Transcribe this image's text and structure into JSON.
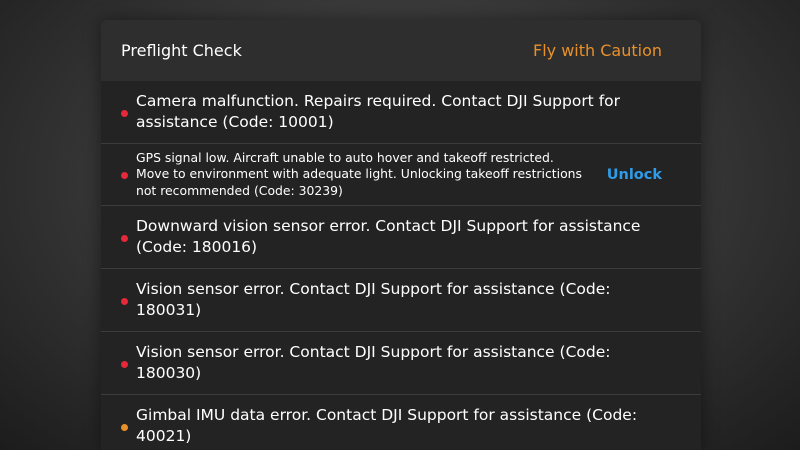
{
  "header": {
    "title": "Preflight Check",
    "status": "Fly with Caution"
  },
  "colors": {
    "error": "#e5283a",
    "warning": "#e8912a",
    "link": "#2e9ce8"
  },
  "items": [
    {
      "severity": "error",
      "message": "Camera malfunction. Repairs required. Contact DJI Support for assistance (Code: 10001)"
    },
    {
      "severity": "error",
      "message": "GPS signal low. Aircraft unable to auto hover and takeoff restricted. Move to environment with adequate light. Unlocking takeoff restrictions not recommended (Code: 30239)",
      "action": "Unlock"
    },
    {
      "severity": "error",
      "message": "Downward vision sensor error. Contact DJI Support for assistance (Code: 180016)"
    },
    {
      "severity": "error",
      "message": "Vision sensor error. Contact DJI Support for assistance (Code: 180031)"
    },
    {
      "severity": "error",
      "message": "Vision sensor error. Contact DJI Support for assistance (Code: 180030)"
    },
    {
      "severity": "warning",
      "message": "Gimbal IMU data error. Contact DJI Support for assistance (Code: 40021)"
    }
  ]
}
